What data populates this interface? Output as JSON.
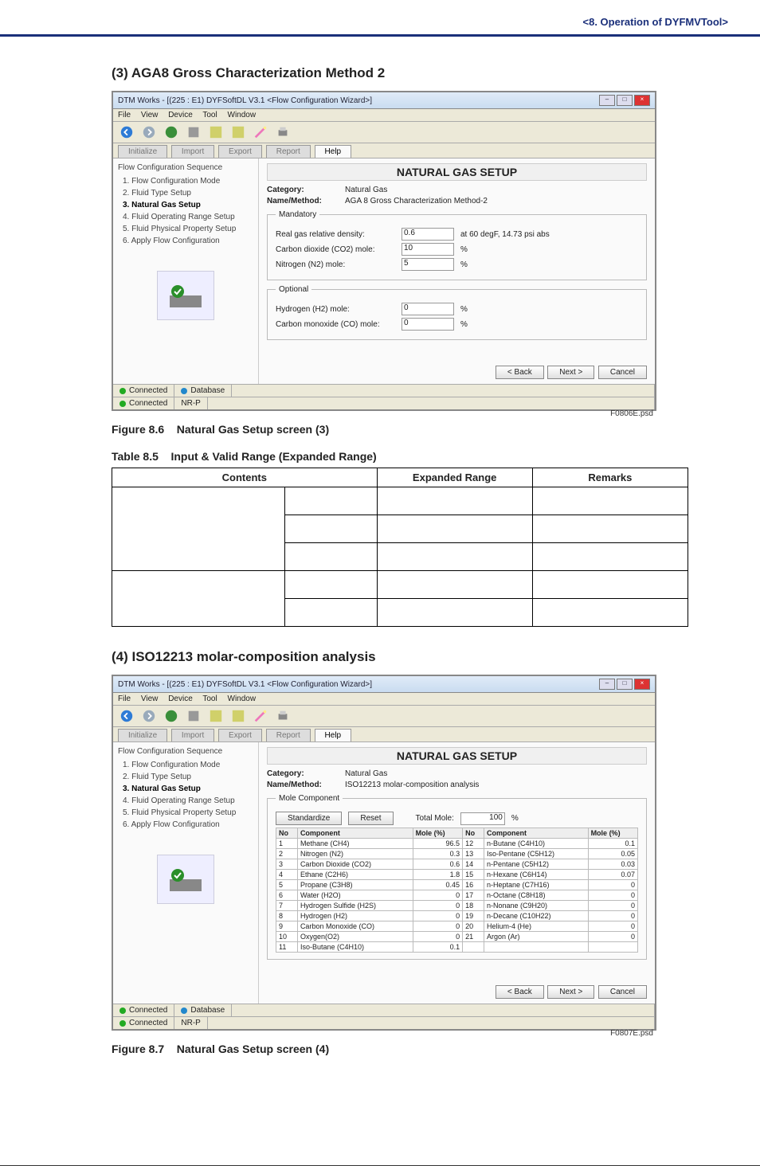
{
  "header": {
    "breadcrumb": "<8.  Operation of DYFMVTool>"
  },
  "section3": {
    "num_title": "(3)   AGA8 Gross Characterization Method 2"
  },
  "section4": {
    "num_title": "(4)   ISO12213 molar-composition analysis"
  },
  "fig86": {
    "label": "Figure 8.6",
    "title": "Natural Gas Setup screen (3)",
    "imgnum": "F0806E.psd"
  },
  "fig87": {
    "label": "Figure 8.7",
    "title": "Natural Gas Setup screen (4)",
    "imgnum": "F0807E.psd"
  },
  "table85": {
    "label": "Table 8.5",
    "title": "Input & Valid Range (Expanded Range)",
    "headers": [
      "Contents",
      "Expanded Range",
      "Remarks"
    ]
  },
  "ss_common": {
    "titlebar": "DTM Works - [(225 : E1) DYFSoftDL V3.1 <Flow Configuration Wizard>]",
    "menu": [
      "File",
      "View",
      "Device",
      "Tool",
      "Window"
    ],
    "tabs": [
      "Initialize",
      "Import",
      "Export",
      "Report",
      "Help"
    ],
    "sidebar_head": "Flow Configuration Sequence",
    "steps": [
      "1. Flow Configuration Mode",
      "2. Fluid Type Setup",
      "3. Natural Gas Setup",
      "4. Fluid Operating Range Setup",
      "5. Fluid Physical Property Setup",
      "6. Apply Flow Configuration"
    ],
    "main_title": "NATURAL GAS SETUP",
    "cat_lbl": "Category:",
    "cat_val": "Natural Gas",
    "nm_lbl": "Name/Method:",
    "back": "< Back",
    "next": "Next >",
    "cancel": "Cancel",
    "status_connected": "Connected",
    "status_db": "Database",
    "status_nrp": "NR-P"
  },
  "ss1": {
    "method": "AGA 8 Gross Characterization Method-2",
    "mandatory": "Mandatory",
    "optional": "Optional",
    "rows_m": [
      {
        "lbl": "Real gas relative density:",
        "val": "0.6",
        "unit": "at 60 degF, 14.73 psi abs"
      },
      {
        "lbl": "Carbon dioxide (CO2) mole:",
        "val": "10",
        "unit": "%"
      },
      {
        "lbl": "Nitrogen (N2) mole:",
        "val": "5",
        "unit": "%"
      }
    ],
    "rows_o": [
      {
        "lbl": "Hydrogen (H2) mole:",
        "val": "0",
        "unit": "%"
      },
      {
        "lbl": "Carbon monoxide (CO) mole:",
        "val": "0",
        "unit": "%"
      }
    ]
  },
  "ss2": {
    "method": "ISO12213 molar-composition analysis",
    "mole_comp": "Mole Component",
    "btn_std": "Standardize",
    "btn_reset": "Reset",
    "total_lbl": "Total Mole:",
    "total_val": "100",
    "total_unit": "%",
    "headers": [
      "No",
      "Component",
      "Mole (%)",
      "No",
      "Component",
      "Mole (%)"
    ],
    "rows": [
      [
        "1",
        "Methane (CH4)",
        "96.5",
        "12",
        "n-Butane (C4H10)",
        "0.1"
      ],
      [
        "2",
        "Nitrogen (N2)",
        "0.3",
        "13",
        "Iso-Pentane (C5H12)",
        "0.05"
      ],
      [
        "3",
        "Carbon Dioxide (CO2)",
        "0.6",
        "14",
        "n-Pentane (C5H12)",
        "0.03"
      ],
      [
        "4",
        "Ethane (C2H6)",
        "1.8",
        "15",
        "n-Hexane (C6H14)",
        "0.07"
      ],
      [
        "5",
        "Propane (C3H8)",
        "0.45",
        "16",
        "n-Heptane (C7H16)",
        "0"
      ],
      [
        "6",
        "Water (H2O)",
        "0",
        "17",
        "n-Octane (C8H18)",
        "0"
      ],
      [
        "7",
        "Hydrogen Sulfide (H2S)",
        "0",
        "18",
        "n-Nonane (C9H20)",
        "0"
      ],
      [
        "8",
        "Hydrogen (H2)",
        "0",
        "19",
        "n-Decane (C10H22)",
        "0"
      ],
      [
        "9",
        "Carbon Monoxide (CO)",
        "0",
        "20",
        "Helium-4 (He)",
        "0"
      ],
      [
        "10",
        "Oxygen(O2)",
        "0",
        "21",
        "Argon (Ar)",
        "0"
      ],
      [
        "11",
        "Iso-Butane (C4H10)",
        "0.1",
        "",
        "",
        ""
      ]
    ]
  },
  "chart_data": null
}
